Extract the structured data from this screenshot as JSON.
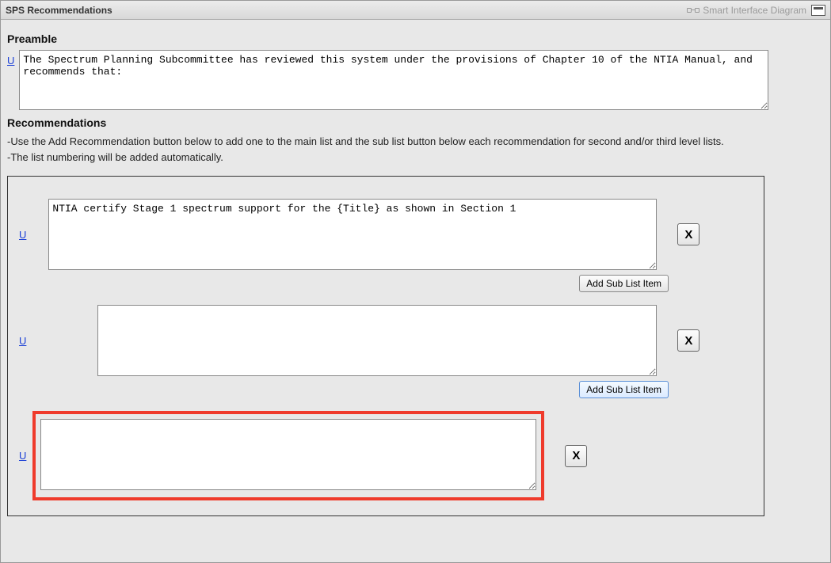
{
  "header": {
    "title": "SPS Recommendations",
    "smart_link": "Smart Interface Diagram"
  },
  "preamble": {
    "title": "Preamble",
    "u_label": "U",
    "text": "The Spectrum Planning Subcommittee has reviewed this system under the provisions of Chapter 10 of the NTIA Manual, and recommends that:"
  },
  "recommendations": {
    "title": "Recommendations",
    "instruction1": "-Use the Add Recommendation button below to add one to the main list and the sub list button below each recommendation for second and/or third level lists.",
    "instruction2": "-The list numbering will be added automatically.",
    "items": [
      {
        "u_label": "U",
        "text": "NTIA certify Stage 1 spectrum support for the {Title} as shown in Section 1",
        "delete_icon": "X",
        "add_sub_label": "Add Sub List Item"
      },
      {
        "u_label": "U",
        "text": "",
        "delete_icon": "X",
        "add_sub_label": "Add Sub List Item"
      },
      {
        "u_label": "U",
        "text": "",
        "delete_icon": "X"
      }
    ]
  }
}
